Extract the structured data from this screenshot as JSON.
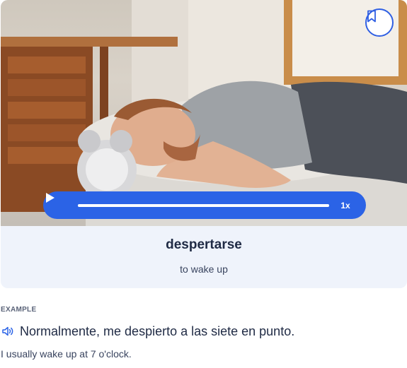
{
  "flashcard": {
    "word": "despertarse",
    "translation": "to wake up"
  },
  "audio_player": {
    "speed_label": "1x",
    "progress": 1.0
  },
  "example": {
    "label": "EXAMPLE",
    "sentence": "Normalmente, me despierto a las siete en punto.",
    "translation": "I usually wake up at 7 o'clock."
  },
  "icons": {
    "bookmark": "bookmark-icon",
    "play": "play-icon",
    "speaker": "speaker-icon"
  },
  "colors": {
    "accent": "#2b63e6",
    "card_background": "#eff3fb",
    "text_primary": "#1f2a44"
  }
}
